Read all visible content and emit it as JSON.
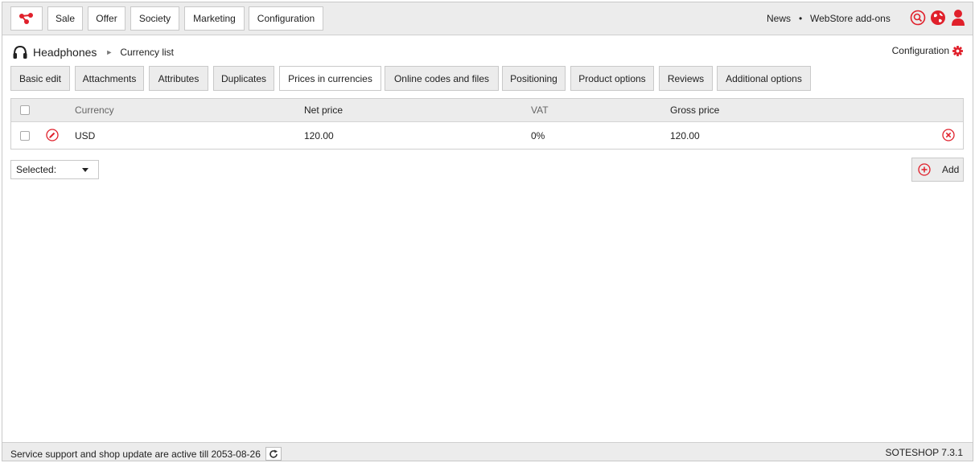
{
  "brand_color": "#e0202b",
  "topbar": {
    "logo_icon": "share-nodes-icon",
    "menu": [
      "Sale",
      "Offer",
      "Society",
      "Marketing",
      "Configuration"
    ],
    "links": {
      "news": "News",
      "separator": "•",
      "addons": "WebStore add-ons"
    },
    "icons": [
      "search-icon",
      "globe-icon",
      "user-icon"
    ]
  },
  "header": {
    "product_icon": "headphones-icon",
    "product": "Headphones",
    "separator": "►",
    "page": "Currency list",
    "config_link": "Configuration",
    "config_icon": "gear-icon"
  },
  "tabs": [
    {
      "label": "Basic edit",
      "active": false
    },
    {
      "label": "Attachments",
      "active": false
    },
    {
      "label": "Attributes",
      "active": false
    },
    {
      "label": "Duplicates",
      "active": false
    },
    {
      "label": "Prices in currencies",
      "active": true
    },
    {
      "label": "Online codes and files",
      "active": false
    },
    {
      "label": "Positioning",
      "active": false
    },
    {
      "label": "Product options",
      "active": false
    },
    {
      "label": "Reviews",
      "active": false
    },
    {
      "label": "Additional options",
      "active": false
    }
  ],
  "table": {
    "columns": [
      "Currency",
      "Net price",
      "VAT",
      "Gross price"
    ],
    "rows": [
      {
        "currency": "USD",
        "net_price": "120.00",
        "vat": "0%",
        "gross_price": "120.00"
      }
    ]
  },
  "actions": {
    "selected_label": "Selected:",
    "add_label": "Add"
  },
  "footer": {
    "service_text": "Service support and shop update are active till 2053-08-26",
    "version": "SOTESHOP 7.3.1"
  }
}
